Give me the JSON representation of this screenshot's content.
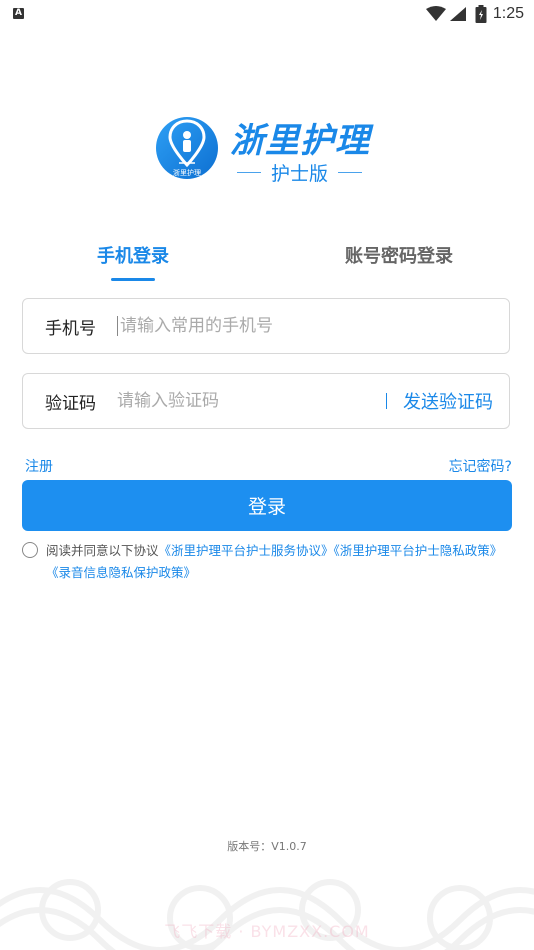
{
  "status_bar": {
    "notification_glyph": "A",
    "time": "1:25",
    "icons": [
      "wifi-icon",
      "signal-icon",
      "battery-icon"
    ]
  },
  "logo": {
    "app_name": "浙里护理",
    "edition": "护士版",
    "badge_text": "浙里护理"
  },
  "tabs": {
    "phone_login": "手机登录",
    "account_login": "账号密码登录"
  },
  "phone_field": {
    "label": "手机号",
    "placeholder": "请输入常用的手机号"
  },
  "code_field": {
    "label": "验证码",
    "placeholder": "请输入验证码",
    "send_label": "发送验证码"
  },
  "links": {
    "register": "注册",
    "forgot_password": "忘记密码?"
  },
  "login_button": "登录",
  "agreement": {
    "prefix": "阅读并同意以下协议",
    "links": [
      "《浙里护理平台护士服务协议》",
      "《浙里护理平台护士隐私政策》",
      "《录音信息隐私保护政策》"
    ]
  },
  "version": "版本号：V1.0.7",
  "watermark": "飞飞下载 · BYMZXX.COM",
  "colors": {
    "brand_blue": "#1d8ff0",
    "link_blue": "#1a88e8",
    "border": "#d8d8d8"
  }
}
